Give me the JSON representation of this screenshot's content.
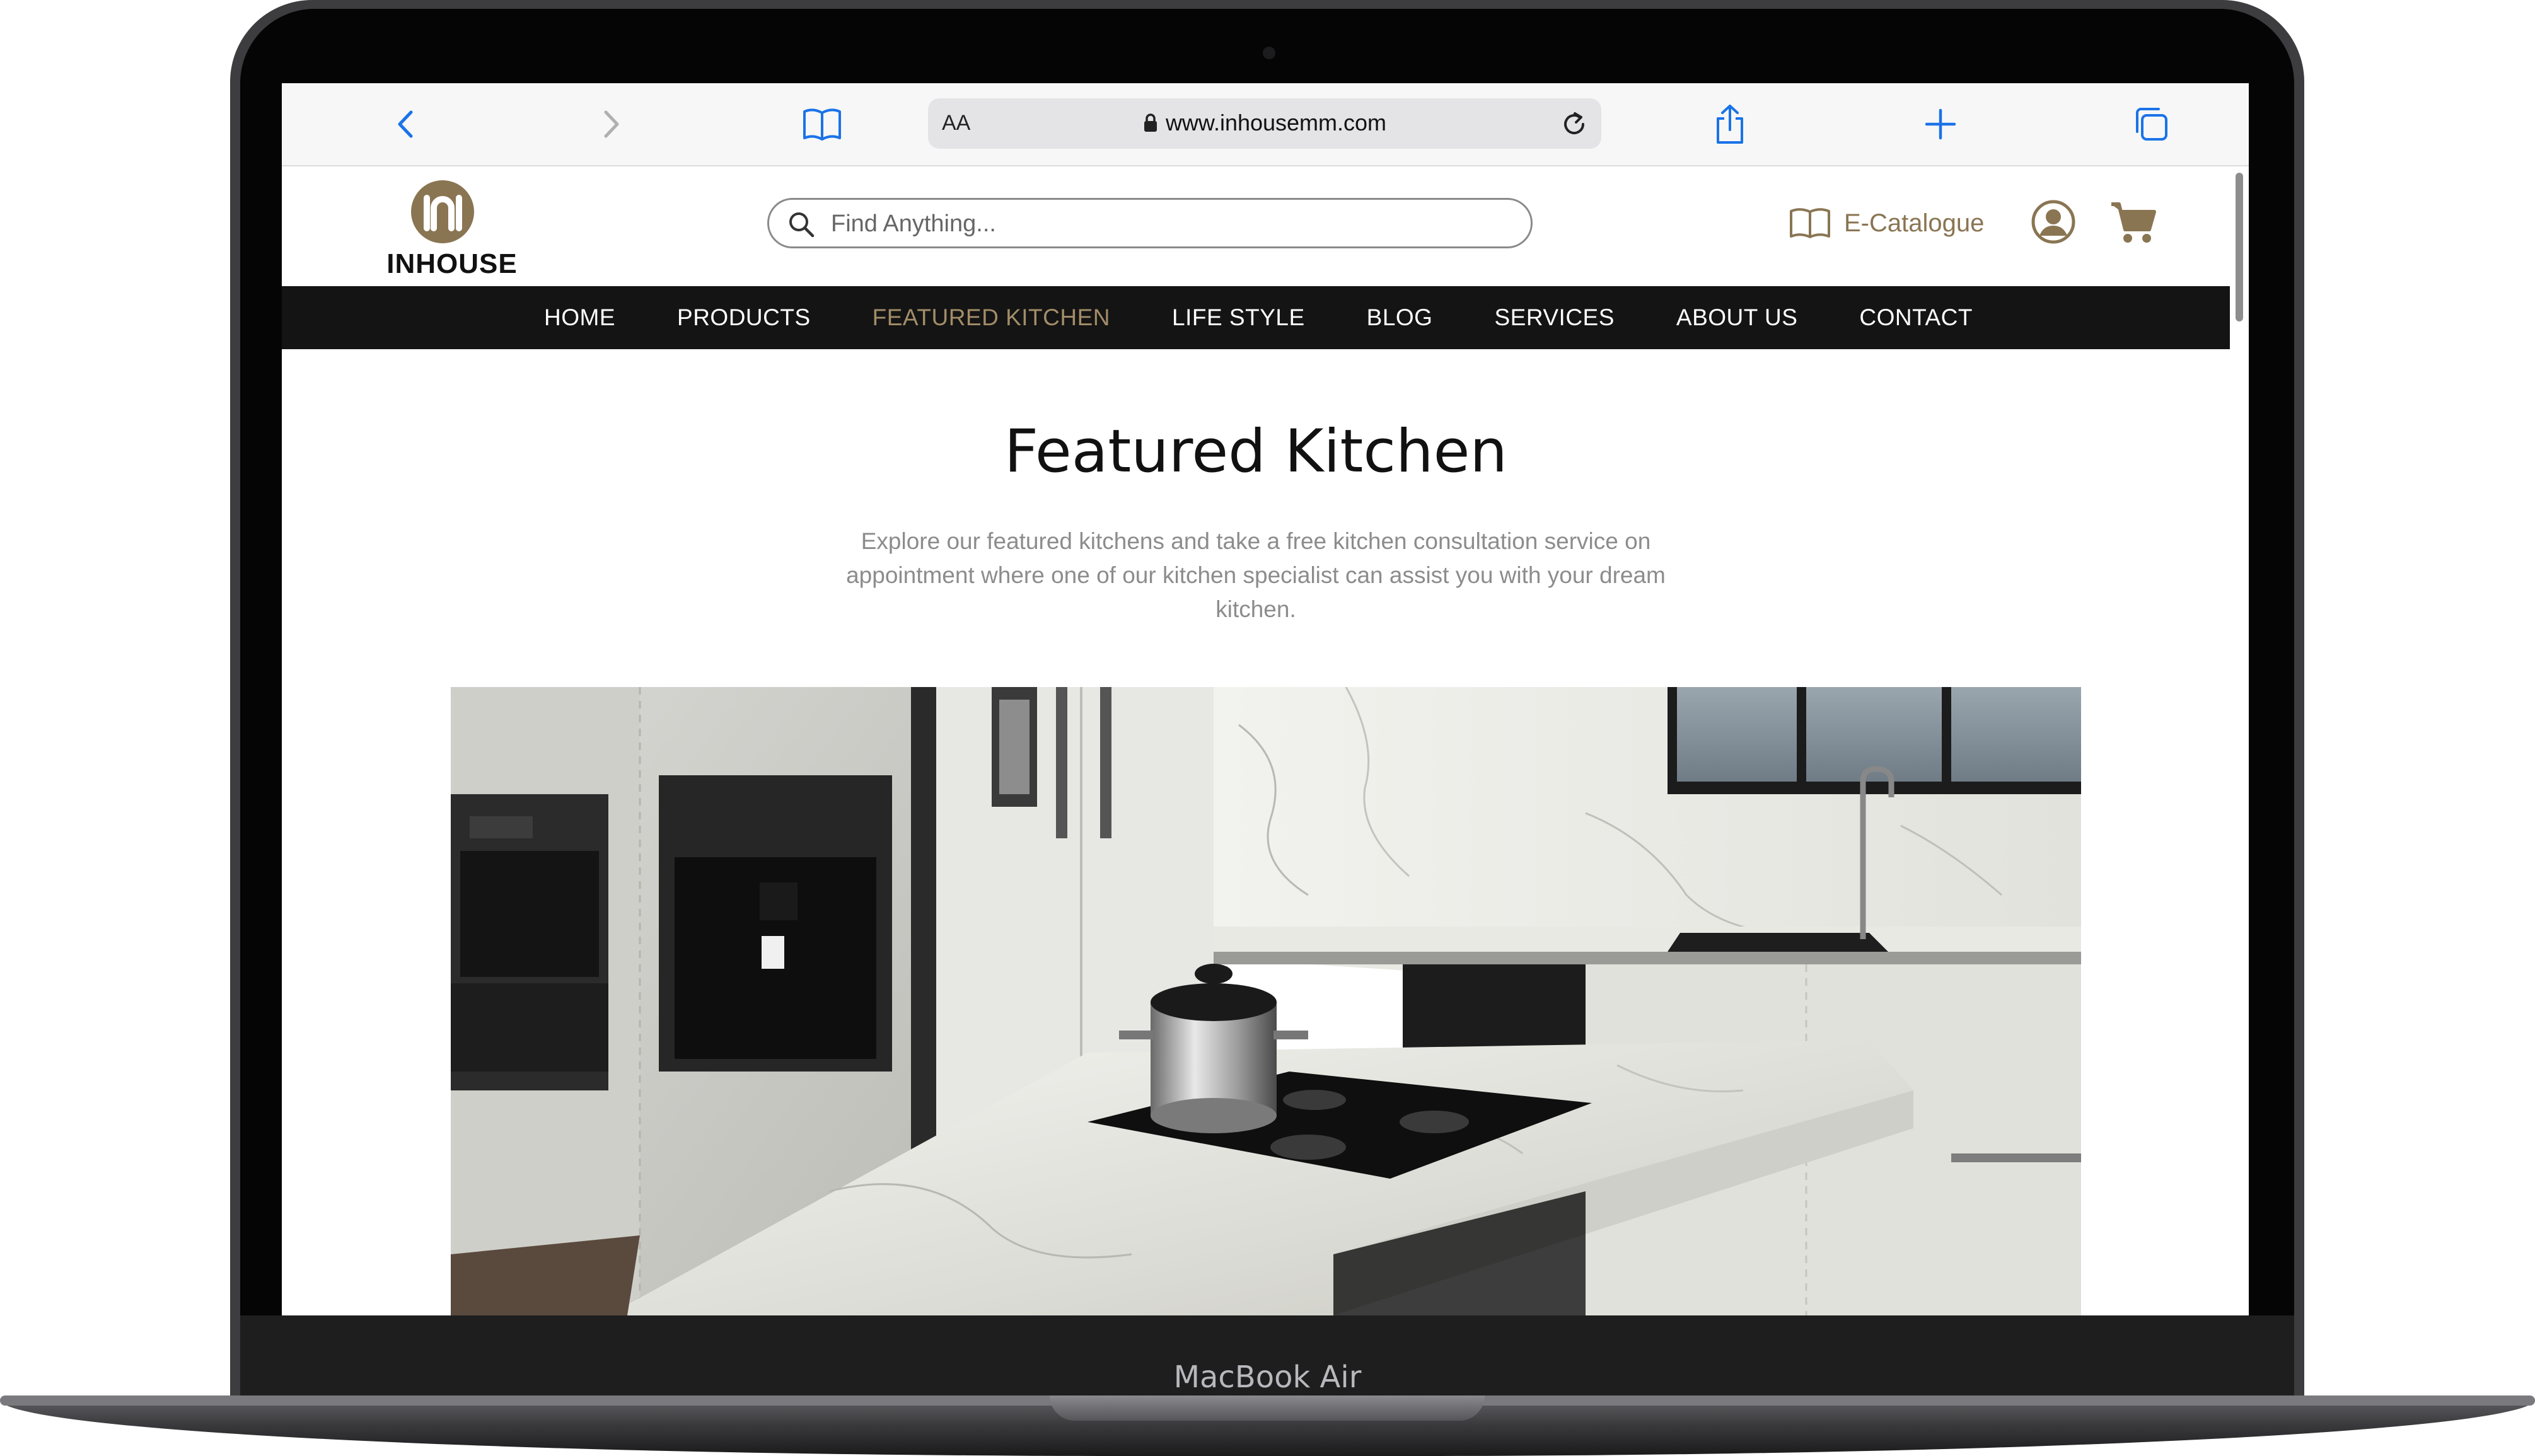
{
  "device": {
    "label": "MacBook Air"
  },
  "browser": {
    "text_size_label": "AA",
    "url": "www.inhousemm.com"
  },
  "site": {
    "logo_text": "INHOUSE",
    "search_placeholder": "Find Anything...",
    "ecatalogue_label": "E-Catalogue",
    "brand_color": "#8a7553",
    "nav": [
      {
        "label": "HOME",
        "active": false
      },
      {
        "label": "PRODUCTS",
        "active": false
      },
      {
        "label": "FEATURED KITCHEN",
        "active": true
      },
      {
        "label": "LIFE STYLE",
        "active": false
      },
      {
        "label": "BLOG",
        "active": false
      },
      {
        "label": "SERVICES",
        "active": false
      },
      {
        "label": "ABOUT US",
        "active": false
      },
      {
        "label": "CONTACT",
        "active": false
      }
    ]
  },
  "page": {
    "title": "Featured Kitchen",
    "description": "Explore our featured kitchens and take a free kitchen consultation service on appointment where one of our kitchen specialist can assist you with your dream kitchen."
  },
  "icons": [
    "back-icon",
    "forward-icon",
    "bookmarks-icon",
    "lock-icon",
    "reload-icon",
    "share-icon",
    "new-tab-icon",
    "tabs-icon",
    "search-icon",
    "book-icon",
    "user-icon",
    "cart-icon"
  ]
}
